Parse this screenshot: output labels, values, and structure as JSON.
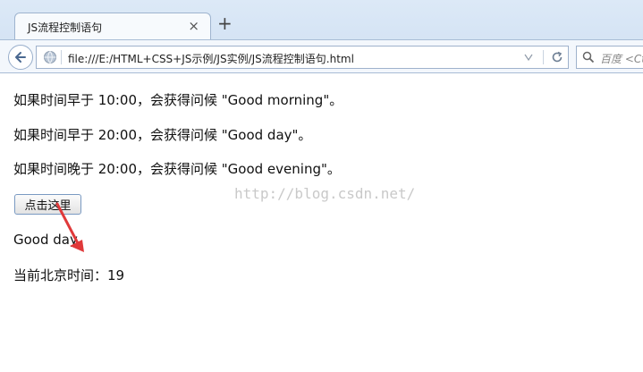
{
  "browser": {
    "tab_title": "JS流程控制语句",
    "tab_close": "×",
    "new_tab": "+",
    "url": "file:///E:/HTML+CSS+JS示例/JS实例/JS流程控制语句.html",
    "search_placeholder": "百度 <Ct"
  },
  "page": {
    "lines": [
      "如果时间早于 10:00，会获得问候 \"Good morning\"。",
      "如果时间早于 20:00，会获得问候 \"Good day\"。",
      "如果时间晚于 20:00，会获得问候 \"Good evening\"。"
    ],
    "button_label": "点击这里",
    "greeting": "Good day",
    "time_line": "当前北京时间：19"
  },
  "watermark": "http://blog.csdn.net/",
  "colors": {
    "annotation_arrow": "#e0393a"
  }
}
